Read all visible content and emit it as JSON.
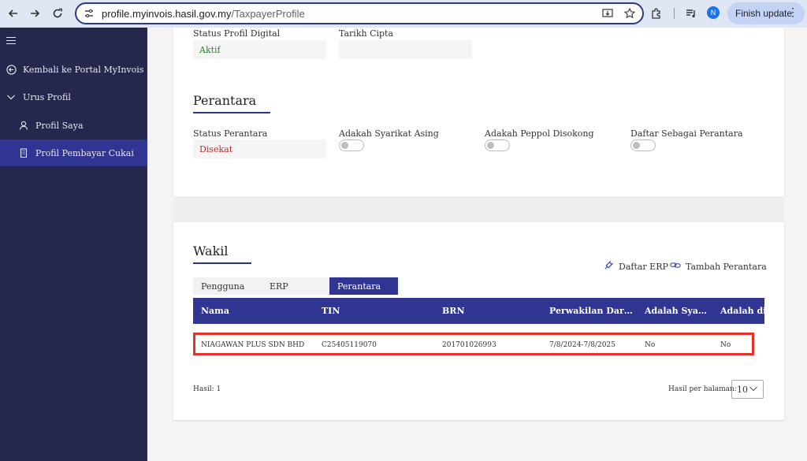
{
  "browser": {
    "url_host": "profile.myinvois.hasil.gov.my",
    "url_path": "/TaxpayerProfile",
    "finish_update": "Finish update",
    "avatar_letter": "N"
  },
  "sidebar": {
    "items": [
      {
        "label": "Kembali ke Portal MyInvois"
      },
      {
        "label": "Urus Profil"
      },
      {
        "label": "Profil Saya"
      },
      {
        "label": "Profil Pembayar Cukai"
      }
    ]
  },
  "digital": {
    "status_label": "Status Profil Digital",
    "status_value": "Aktif",
    "created_label": "Tarikh Cipta",
    "created_value": ""
  },
  "perantara": {
    "title": "Perantara",
    "status_label": "Status Perantara",
    "status_value": "Disekat",
    "foreign_label": "Adakah Syarikat Asing",
    "peppol_label": "Adakah Peppol Disokong",
    "register_label": "Daftar Sebagai Perantara"
  },
  "wakil": {
    "title": "Wakil",
    "daftar_erp": "Daftar ERP",
    "tambah_perantara": "Tambah Perantara",
    "tabs": [
      {
        "label": "Pengguna"
      },
      {
        "label": "ERP"
      },
      {
        "label": "Perantara"
      }
    ],
    "columns": [
      "Nama",
      "TIN",
      "BRN",
      "Perwakilan Dari - …",
      "Adalah Syari…",
      "Adalah disokong"
    ],
    "rows": [
      {
        "nama": "NIAGAWAN PLUS SDN BHD",
        "tin": "C25405119070",
        "brn": "201701026993",
        "perwakilan": "7/8/2024-7/8/2025",
        "syarikat": "No",
        "disokong": "No"
      }
    ],
    "hasil": "Hasil: 1",
    "per_page_label": "Hasil per halaman:",
    "per_page_value": "10"
  },
  "colors": {
    "accent": "#303592",
    "sidebar_bg": "#25274d",
    "status_active": "#2e7d32",
    "status_blocked": "#c62828",
    "highlight": "#e53227"
  }
}
